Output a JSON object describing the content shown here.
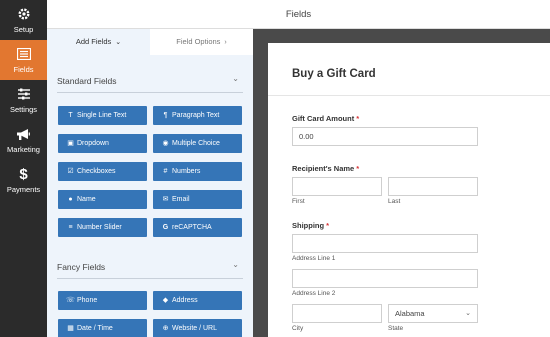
{
  "header": {
    "title": "Fields"
  },
  "rail": {
    "items": [
      {
        "label": "Setup",
        "icon": "gear-icon"
      },
      {
        "label": "Fields",
        "icon": "fields-list-icon",
        "active": true
      },
      {
        "label": "Settings",
        "icon": "sliders-icon"
      },
      {
        "label": "Marketing",
        "icon": "megaphone-icon"
      },
      {
        "label": "Payments",
        "icon": "dollar-icon",
        "glyph": "$"
      }
    ]
  },
  "tabs": {
    "add_fields": "Add Fields",
    "add_fields_chevron": "⌄",
    "field_options": "Field Options",
    "field_options_chevron": "›"
  },
  "sections": {
    "standard": {
      "label": "Standard Fields",
      "chevron": "⌄"
    },
    "fancy": {
      "label": "Fancy Fields",
      "chevron": "⌄"
    }
  },
  "standard_fields": [
    {
      "label": "Single Line Text",
      "glyph": "T"
    },
    {
      "label": "Paragraph Text",
      "glyph": "¶"
    },
    {
      "label": "Dropdown",
      "glyph": "▣"
    },
    {
      "label": "Multiple Choice",
      "glyph": "◉"
    },
    {
      "label": "Checkboxes",
      "glyph": "☑"
    },
    {
      "label": "Numbers",
      "glyph": "#"
    },
    {
      "label": "Name",
      "glyph": "●"
    },
    {
      "label": "Email",
      "glyph": "✉"
    },
    {
      "label": "Number Slider",
      "glyph": "≡"
    },
    {
      "label": "reCAPTCHA",
      "glyph": "G"
    }
  ],
  "fancy_fields": [
    {
      "label": "Phone",
      "glyph": "☏"
    },
    {
      "label": "Address",
      "glyph": "◆"
    },
    {
      "label": "Date / Time",
      "glyph": "▦"
    },
    {
      "label": "Website / URL",
      "glyph": "⊕"
    }
  ],
  "form": {
    "title": "Buy a Gift Card",
    "required_mark": "*",
    "gift_card_amount": {
      "label": "Gift Card Amount",
      "value": "0.00"
    },
    "recipient_name": {
      "label": "Recipient's Name",
      "first": "First",
      "last": "Last"
    },
    "shipping": {
      "label": "Shipping",
      "address1": "Address Line 1",
      "address2": "Address Line 2",
      "city": "City",
      "state": "State",
      "state_value": "Alabama",
      "state_chevron": "⌄"
    }
  },
  "colors": {
    "rail_bg": "#2b2b2b",
    "active_accent": "#e27730",
    "field_button": "#3575b7",
    "panel_bg": "#eef4fb",
    "required": "#d63638"
  }
}
